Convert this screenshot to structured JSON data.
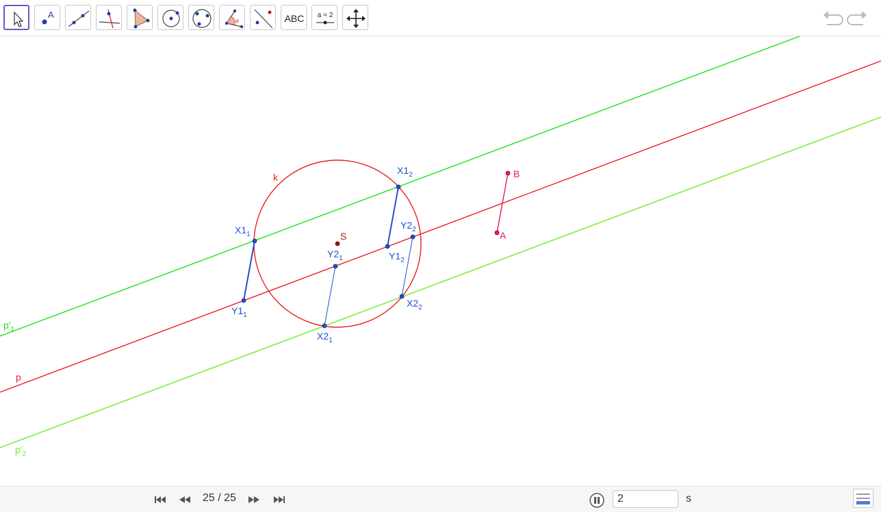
{
  "toolbar": {
    "tools": [
      {
        "name": "move-tool",
        "active": true
      },
      {
        "name": "point-tool",
        "glyph": "A"
      },
      {
        "name": "line-tool"
      },
      {
        "name": "perpendicular-line-tool"
      },
      {
        "name": "polygon-tool"
      },
      {
        "name": "circle-tool"
      },
      {
        "name": "conic-tool"
      },
      {
        "name": "angle-tool",
        "glyph": "α"
      },
      {
        "name": "reflect-tool"
      },
      {
        "name": "text-tool",
        "glyph": "ABC"
      },
      {
        "name": "slider-tool",
        "glyph": "a = 2"
      },
      {
        "name": "move-graphics-view-tool"
      }
    ],
    "undo_icon": "undo-icon",
    "redo_icon": "redo-icon"
  },
  "labels": {
    "k": "k",
    "S": "S",
    "A": "A",
    "B": "B",
    "p": "p",
    "p1": "p'",
    "p1_sub": "1",
    "p2": "p'",
    "p2_sub": "2",
    "X1_1": "X1",
    "X1_1_sub": "1",
    "Y1_1": "Y1",
    "Y1_1_sub": "1",
    "X2_1": "X2",
    "X2_1_sub": "1",
    "Y2_1": "Y2",
    "Y2_1_sub": "1",
    "X1_2": "X1",
    "X1_2_sub": "2",
    "Y1_2": "Y1",
    "Y1_2_sub": "2",
    "X2_2": "X2",
    "X2_2_sub": "2",
    "Y2_2": "Y2",
    "Y2_2_sub": "2"
  },
  "colors": {
    "red": "#ee1b25",
    "green_bright": "#22dd22",
    "green_light": "#66ee22",
    "blue": "#1f4fcc",
    "crimson": "#e8185a",
    "dark_red": "#a01010",
    "accent": "#6557d2"
  },
  "footer": {
    "step_counter": "25 / 25",
    "speed_value": "2",
    "speed_unit": "s"
  }
}
